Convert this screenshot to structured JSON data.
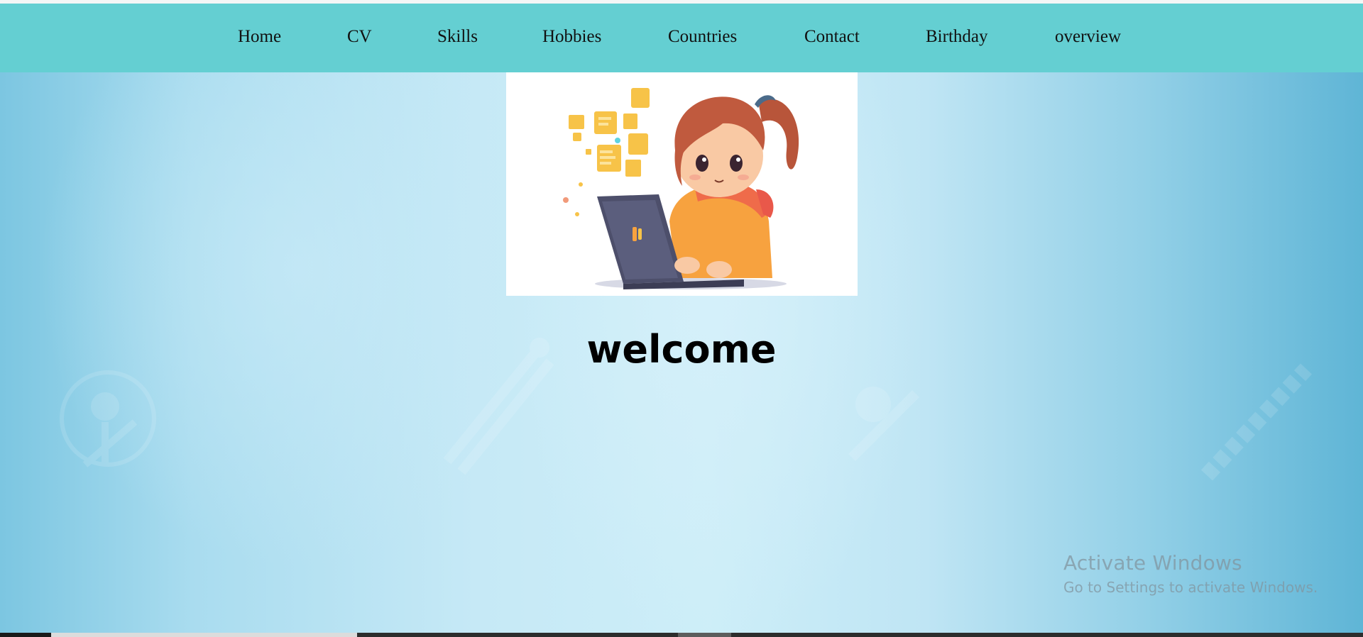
{
  "nav": {
    "items": [
      {
        "label": "Home"
      },
      {
        "label": "CV"
      },
      {
        "label": "Skills"
      },
      {
        "label": "Hobbies"
      },
      {
        "label": "Countries"
      },
      {
        "label": "Contact"
      },
      {
        "label": "Birthday"
      },
      {
        "label": "overview"
      }
    ]
  },
  "hero": {
    "image_icon": "girl-with-laptop-illustration"
  },
  "main": {
    "heading": "welcome"
  },
  "os_overlay": {
    "title": "Activate Windows",
    "subtitle": "Go to Settings to activate Windows."
  },
  "colors": {
    "navbar": "#64cfd2",
    "background_center": "#cdeef8",
    "background_edge": "#5fb5d6"
  }
}
